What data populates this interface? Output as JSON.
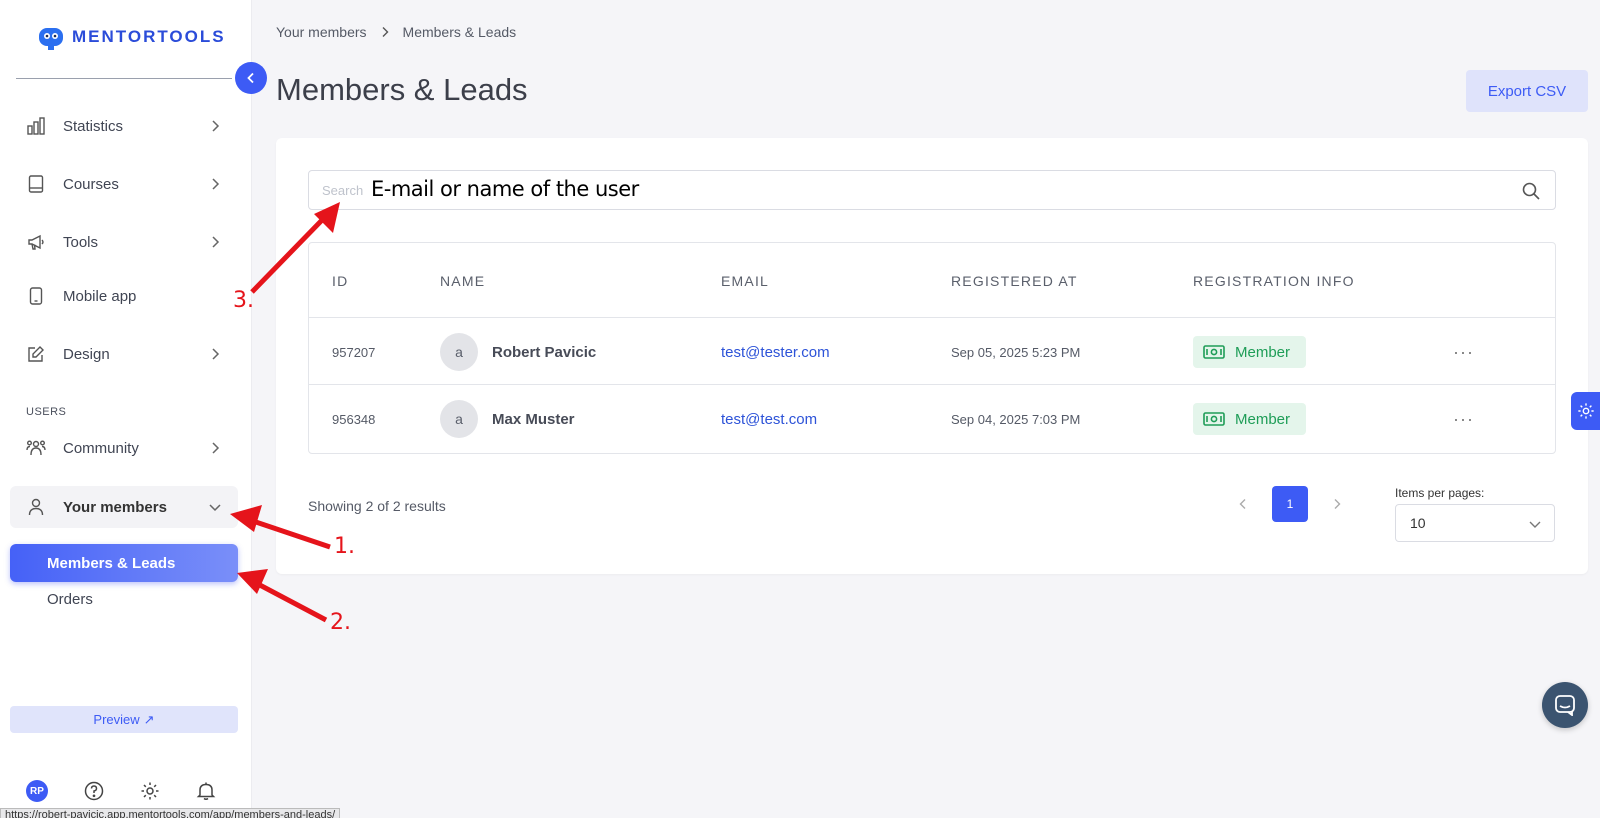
{
  "app": {
    "logo_text": "MENTORTOOLS"
  },
  "sidebar": {
    "items": [
      {
        "label": "Statistics",
        "icon": "bar-chart-icon"
      },
      {
        "label": "Courses",
        "icon": "book-icon"
      },
      {
        "label": "Tools",
        "icon": "megaphone-icon"
      },
      {
        "label": "Mobile app",
        "icon": "phone-icon"
      },
      {
        "label": "Design",
        "icon": "edit-icon"
      }
    ],
    "section_users": "USERS",
    "community": "Community",
    "your_members": "Your members",
    "members_leads": "Members & Leads",
    "orders": "Orders",
    "preview": "Preview",
    "preview_arrow": "↗",
    "avatar_initials": "RP",
    "status_url": "https://robert-pavicic.app.mentortools.com/app/members-and-leads/"
  },
  "header": {
    "breadcrumb": [
      "Your members",
      "Members & Leads"
    ],
    "title": "Members & Leads",
    "export_label": "Export CSV"
  },
  "search": {
    "placeholder": "Search",
    "annotation": "E-mail or name of the user"
  },
  "table": {
    "columns": [
      "ID",
      "NAME",
      "EMAIL",
      "REGISTERED AT",
      "REGISTRATION INFO"
    ],
    "rows": [
      {
        "id": "957207",
        "avatar": "a",
        "name": "Robert Pavicic",
        "email": "test@tester.com",
        "registered": "Sep 05, 2025 5:23 PM",
        "info": "Member"
      },
      {
        "id": "956348",
        "avatar": "a",
        "name": "Max Muster",
        "email": "test@test.com",
        "registered": "Sep 04, 2025 7:03 PM",
        "info": "Member"
      }
    ],
    "more": "···"
  },
  "footer": {
    "showing": "Showing 2 of 2 results",
    "page": "1",
    "items_per_page_label": "Items per pages:",
    "items_per_page_value": "10"
  },
  "annotations": {
    "one": "1.",
    "two": "2.",
    "three": "3."
  },
  "colors": {
    "accent": "#3d5bf5",
    "success": "#1e9d57",
    "annotation": "#e5141b"
  }
}
